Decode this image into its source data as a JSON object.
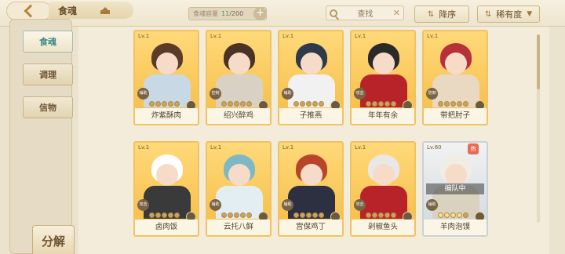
{
  "header": {
    "title": "食魂",
    "capacity_label": "食魂容量",
    "capacity_current": "11",
    "capacity_total": "/200",
    "capacity_add": "+",
    "search_placeholder": "查找",
    "clear_symbol": "✕",
    "order_label": "降序",
    "rarity_label": "稀有度"
  },
  "sidebar": {
    "tabs": [
      {
        "label": "食魂",
        "active": true
      },
      {
        "label": "调理",
        "active": false
      },
      {
        "label": "信物",
        "active": false
      }
    ],
    "decompose_label": "分解"
  },
  "cards": [
    {
      "name": "炸紫酥肉",
      "level": "Lv.1",
      "role": "辅助",
      "hair": "#5b3a2a",
      "body": "#c8d8e4",
      "stars_lit": 0
    },
    {
      "name": "绍兴醉鸡",
      "level": "Lv.1",
      "role": "控制",
      "hair": "#4a3326",
      "body": "#d9d2c4",
      "stars_lit": 0
    },
    {
      "name": "子推燕",
      "level": "Lv.1",
      "role": "辅助",
      "hair": "#2d3a4a",
      "body": "#f1f1f1",
      "stars_lit": 0
    },
    {
      "name": "年年有余",
      "level": "Lv.1",
      "role": "攻击",
      "hair": "#2a2a2a",
      "body": "#b8232a",
      "stars_lit": 0
    },
    {
      "name": "带把肘子",
      "level": "Lv.1",
      "role": "防御",
      "hair": "#b8303a",
      "body": "#e9d8c2",
      "stars_lit": 0
    },
    {
      "name": "卤肉饭",
      "level": "Lv.1",
      "role": "攻击",
      "hair": "#ffffff",
      "body": "#3a3a3a",
      "stars_lit": 0
    },
    {
      "name": "云托八鲜",
      "level": "Lv.1",
      "role": "辅助",
      "hair": "#7fb8c4",
      "body": "#e3eef2",
      "stars_lit": 0
    },
    {
      "name": "宫保鸡丁",
      "level": "Lv.1",
      "role": "辅助",
      "hair": "#b8452a",
      "body": "#2d3040",
      "stars_lit": 0
    },
    {
      "name": "剁椒鱼头",
      "level": "Lv.1",
      "role": "攻击",
      "hair": "#e8e8e8",
      "body": "#b8232a",
      "stars_lit": 0
    },
    {
      "name": "羊肉泡馍",
      "level": "Lv.60",
      "role": "辅助",
      "hair": "#f0ede4",
      "body": "#d8d2bf",
      "stars_lit": 4,
      "rarity": "ssr",
      "team_label": "编队中",
      "badge": "热"
    }
  ]
}
